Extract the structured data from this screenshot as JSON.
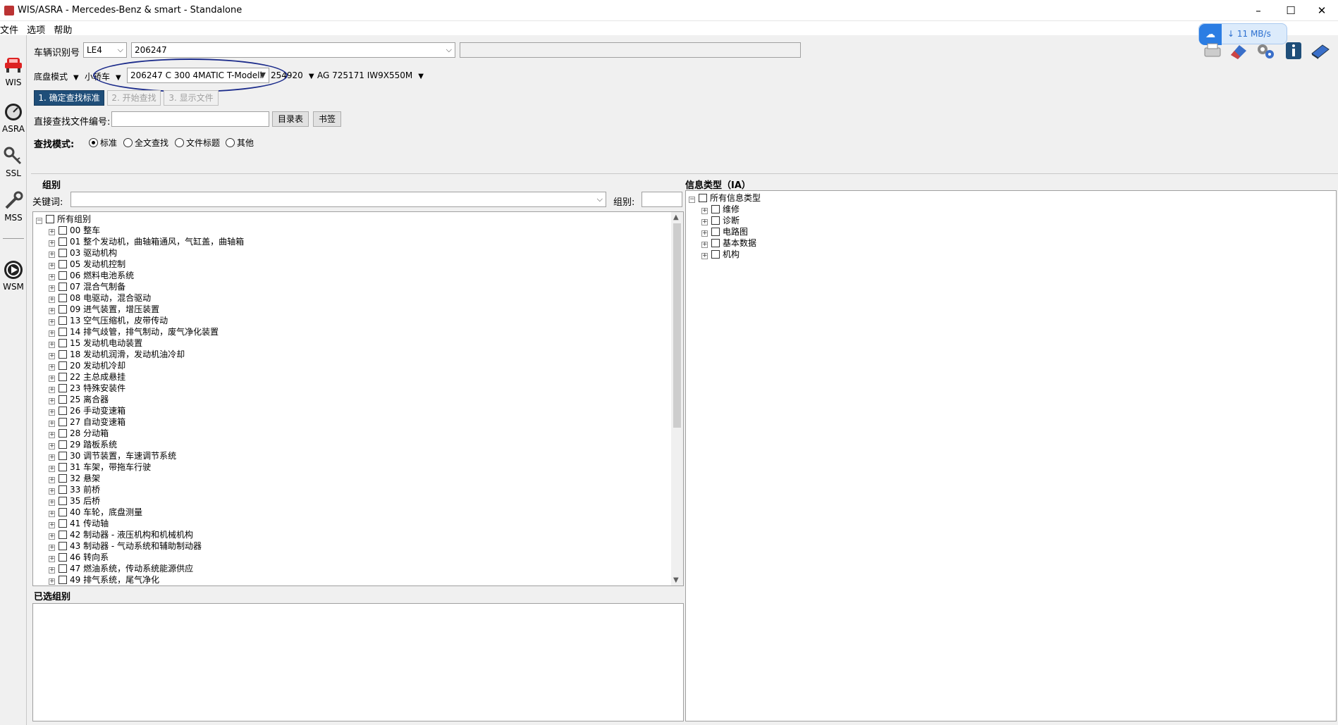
{
  "window": {
    "title": "WIS/ASRA - Mercedes-Benz & smart - Standalone",
    "minimize": "–",
    "maximize": "☐",
    "close": "✕"
  },
  "menu": [
    "文件",
    "选项",
    "帮助"
  ],
  "sidebar": [
    {
      "label": "WIS",
      "icon": "car-icon"
    },
    {
      "label": "ASRA",
      "icon": "gauge-icon"
    },
    {
      "label": "SSL",
      "icon": "key-icon"
    },
    {
      "label": "MSS",
      "icon": "wrench-icon"
    },
    {
      "label": "WSM",
      "icon": "play-icon"
    }
  ],
  "vehicle": {
    "vin_label": "车辆识别号",
    "vin_prefix": "LE4",
    "vin_value": "206247",
    "chassis_label": "底盘模式",
    "vehicle_type": "小轿车",
    "model": "206247 C 300 4MATIC T-Modell",
    "engine": "254920",
    "transmission": "AG 725171 IW9X550M"
  },
  "steps": {
    "step1": "1. 确定查找标准",
    "step2": "2. 开始查找",
    "step3": "3. 显示文件"
  },
  "direct_search": {
    "label": "直接查找文件编号:",
    "toc_button": "目录表",
    "bookmark_button": "书签"
  },
  "search_mode": {
    "label": "查找模式:",
    "options": [
      {
        "label": "标准",
        "selected": true
      },
      {
        "label": "全文查找",
        "selected": false
      },
      {
        "label": "文件标题",
        "selected": false
      },
      {
        "label": "其他",
        "selected": false
      }
    ]
  },
  "groups": {
    "title": "组别",
    "keyword_label": "关键词:",
    "group_label": "组别:",
    "root": "所有组别",
    "items": [
      "00 整车",
      "01 整个发动机，曲轴箱通风，气缸盖，曲轴箱",
      "03 驱动机构",
      "05 发动机控制",
      "06 燃料电池系统",
      "07 混合气制备",
      "08 电驱动，混合驱动",
      "09 进气装置，增压装置",
      "13 空气压缩机，皮带传动",
      "14 排气歧管，排气制动，废气净化装置",
      "15 发动机电动装置",
      "18 发动机润滑，发动机油冷却",
      "20 发动机冷却",
      "22 主总成悬挂",
      "23 特殊安装件",
      "25 离合器",
      "26 手动变速箱",
      "27 自动变速箱",
      "28 分动箱",
      "29 踏板系统",
      "30 调节装置，车速调节系统",
      "31 车架，带拖车行驶",
      "32 悬架",
      "33 前桥",
      "35 后桥",
      "40 车轮，底盘测量",
      "41 传动轴",
      "42 制动器 - 液压机构和机械机构",
      "43 制动器 - 气动系统和辅助制动器",
      "46 转向系",
      "47 燃油系统，传动系统能源供应",
      "49 排气系统，尾气净化"
    ]
  },
  "selected_groups": {
    "title": "已选组别"
  },
  "info_types": {
    "title": "信息类型（IA）",
    "root": "所有信息类型",
    "items": [
      "维修",
      "诊断",
      "电路图",
      "基本数据",
      "机构"
    ]
  },
  "network": {
    "speed": "↓ 11 MB/s"
  },
  "colors": {
    "primary_button": "#1f4e79",
    "annotation_circle": "#1a2a8a",
    "badge": "#2b7de3"
  }
}
